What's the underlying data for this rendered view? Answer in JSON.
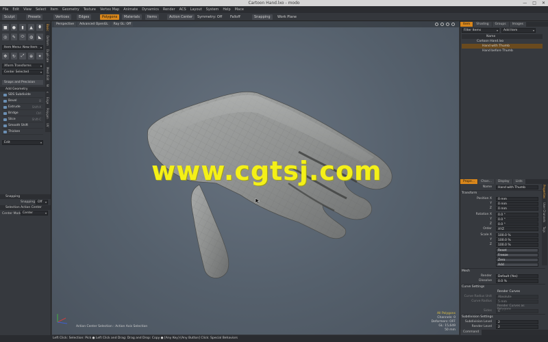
{
  "window": {
    "title": "Cartoon Hand.lxo - modo"
  },
  "menu": [
    "File",
    "Edit",
    "View",
    "Select",
    "Item",
    "Geometry",
    "Texture",
    "Vertex Map",
    "Animate",
    "Dynamics",
    "Render",
    "ACS",
    "Layout",
    "System",
    "Help",
    "Mace"
  ],
  "toolbar": {
    "sculpt": "Sculpt",
    "presets": "Presets",
    "vertices": "Vertices",
    "edges": "Edges",
    "polygons": "Polygons",
    "materials": "Materials",
    "items": "Items",
    "action_center": "Action Center",
    "symmetry": "Symmetry: Off",
    "falloff": "Falloff",
    "snapping": "Snapping",
    "work_plane": "Work Plane"
  },
  "left_panel": {
    "side_tabs": [
      "Basic",
      "Deform",
      "Duplicate",
      "Mesh Edit",
      "Vertex",
      "Edge",
      "Polygon",
      "UV"
    ],
    "item_menu": "Item Menu: New Item",
    "xform": "Xform Transforms",
    "center_selected": "Center Selected",
    "snaps": "Snaps and Precision",
    "add_geometry": "Add Geometry",
    "tools": [
      {
        "label": "SDS Subdivide",
        "shortcut": ""
      },
      {
        "label": "Bevel",
        "shortcut": "B"
      },
      {
        "label": "Extrude",
        "shortcut": "Shift-X"
      },
      {
        "label": "Bridge",
        "shortcut": "Ctrl"
      },
      {
        "label": "Slice",
        "shortcut": "Shift-C"
      },
      {
        "label": "Smooth Shift",
        "shortcut": ""
      },
      {
        "label": "Thicken",
        "shortcut": ""
      }
    ],
    "edit": "Edit",
    "snapping_header": "Snapping",
    "snapping_label": "Snapping",
    "snapping_value": "Off",
    "selection_header": "Selection Action Center",
    "center_mode_label": "Center Mode",
    "center_mode_value": "Center"
  },
  "viewport": {
    "bar": [
      "Perspective",
      "Advanced OpenGL",
      "Ray GL: Off"
    ],
    "watermark": "www.cgtsj.com",
    "caption": "Action Center Selection : Action Axis Selection",
    "info": {
      "mode": "All Polygons",
      "channels": "Channels: 0",
      "deformers": "Deformers: OFF",
      "gl": "GL: 15,649",
      "units": "50 mm"
    }
  },
  "status_bar": "Left Click: Selection: Pick  ● Left Click and Drag: Drag and Drop: Copy  ● [Any Key]-[Any Button] Click: Special Behaviors",
  "right_panel": {
    "top_tabs": [
      "Item",
      "Shading",
      "Groups",
      "Images"
    ],
    "filter_label": "Filter Items",
    "add_item": "Add Item",
    "tree_header": "Name",
    "tree": [
      {
        "label": "Cartoon Hand.lxo",
        "indent": 0,
        "selected": false
      },
      {
        "label": "Hand with Thumb",
        "indent": 1,
        "selected": true
      },
      {
        "label": "Hand before Thumb",
        "indent": 1,
        "selected": false
      }
    ],
    "prop_tabs": [
      "Prope...",
      "Chan...",
      "Display",
      "Lists"
    ],
    "name_label": "Name",
    "name_value": "Hand with Thumb",
    "transform_header": "Transform",
    "position": [
      {
        "label": "Position X",
        "value": "0 mm"
      },
      {
        "label": "Y",
        "value": "0 mm"
      },
      {
        "label": "Z",
        "value": "0 mm"
      }
    ],
    "rotation": [
      {
        "label": "Rotation X",
        "value": "0.0 °"
      },
      {
        "label": "Y",
        "value": "0.0 °"
      },
      {
        "label": "Z",
        "value": "0.0 °"
      }
    ],
    "order_label": "Order",
    "order_value": "XYZ",
    "scale": [
      {
        "label": "Scale X",
        "value": "100.0 %"
      },
      {
        "label": "Y",
        "value": "100.0 %"
      },
      {
        "label": "Z",
        "value": "100.0 %"
      }
    ],
    "actions": [
      "Reset",
      "Freeze",
      "Zero",
      "Add"
    ],
    "mesh_header": "Mesh",
    "render_label": "Render",
    "render_value": "Default (Yes)",
    "dissolve_label": "Dissolve",
    "dissolve_value": "0.0 %",
    "curve_header": "Curve Settings",
    "render_curves": "Render Curves",
    "curve_radius_label": "Curve Radius Unit",
    "curve_radius_value": "Absolute",
    "curve_radius": "Curve Radius",
    "curve_radius_val2": "5 mm",
    "render_curves_poly": "Render Curves as Polygons",
    "sides_label": "Sides",
    "sides_value": "6",
    "subdiv_header": "Subdivision Settings",
    "subdiv_level_label": "Subdivision Level",
    "subdiv_level_value": "2",
    "render_level_label": "Render Level",
    "render_level_value": "2",
    "right_side_tabs": [
      "Properties",
      "User Channels",
      "Tags"
    ],
    "footer": "Command"
  },
  "colors": {
    "accent": "#d8861b",
    "viewport_bg": "#5a6470",
    "watermark": "#f4f018",
    "panel": "#36393e"
  }
}
